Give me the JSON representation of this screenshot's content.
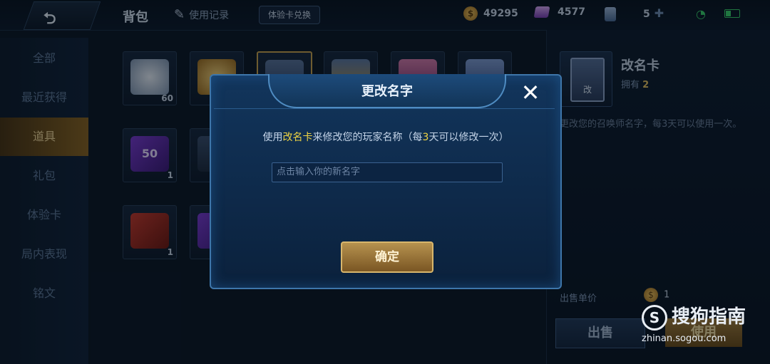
{
  "topbar": {
    "title": "背包",
    "history": "使用记录",
    "redeem": "体验卡兑换",
    "gold": "49295",
    "diamond": "4577",
    "cards": "5"
  },
  "sidebar": {
    "items": [
      {
        "label": "全部"
      },
      {
        "label": "最近获得"
      },
      {
        "label": "道具"
      },
      {
        "label": "礼包"
      },
      {
        "label": "体验卡"
      },
      {
        "label": "局内表现"
      },
      {
        "label": "铭文"
      }
    ]
  },
  "grid": {
    "counts": [
      "60",
      "1",
      "1"
    ],
    "badge_50": "50"
  },
  "detail": {
    "name": "改名卡",
    "own_label": "拥有",
    "own_count": "2",
    "card_label": "改",
    "desc": "更改您的召唤师名字，每3天可以使用一次。",
    "price_label": "出售单价",
    "price_value": "1",
    "sell": "出售",
    "use": "使用"
  },
  "dialog": {
    "title": "更改名字",
    "close": "✕",
    "msg_pre": "使用",
    "msg_item": "改名卡",
    "msg_mid": "来修改您的玩家名称（每",
    "msg_days": "3",
    "msg_post": "天可以修改一次）",
    "input_placeholder": "点击输入你的新名字",
    "confirm": "确定"
  },
  "watermark": {
    "logo": "搜狗指南",
    "url": "zhinan.sogou.com"
  }
}
